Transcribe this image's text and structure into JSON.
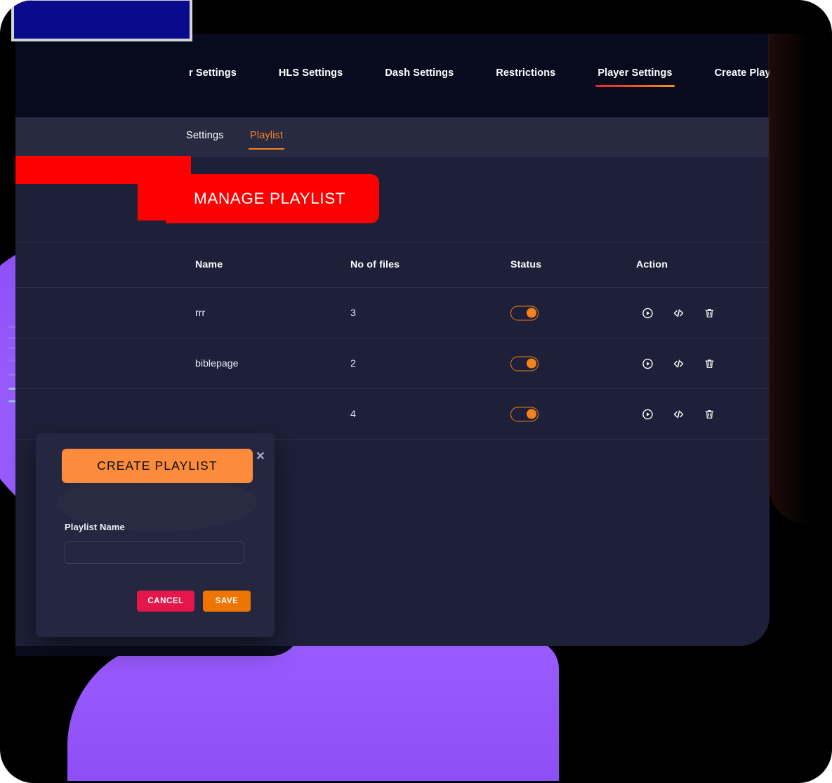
{
  "brand": {
    "accent_orange": "#f5821f",
    "accent_red": "#e8232a",
    "ribbon_red": "#ff0000",
    "cancel_red": "#e4164b",
    "save_orange": "#ee7404",
    "card_bg": "#1e2039",
    "topnav_bg": "#080b1e",
    "subtab_bg": "#282a42",
    "modal_bg": "#252740",
    "modal_header_orange": "#fc8b3c",
    "blob_purple": "#9a5cff",
    "logo_blue": "#0a0a8c"
  },
  "topnav": {
    "items": [
      {
        "label": "r Settings",
        "active": false
      },
      {
        "label": "HLS Settings",
        "active": false
      },
      {
        "label": "Dash Settings",
        "active": false
      },
      {
        "label": "Restrictions",
        "active": false
      },
      {
        "label": "Player Settings",
        "active": true
      },
      {
        "label": "Create Player",
        "active": false
      }
    ]
  },
  "subtabs": {
    "settings_label": "Settings",
    "playlist_label": "Playlist"
  },
  "ribbon": {
    "label": "MANAGE PLAYLIST"
  },
  "toolbar": {
    "create_playlist_label": "Create Playlist"
  },
  "table": {
    "columns": [
      "Name",
      "No of files",
      "Status",
      "Action"
    ],
    "rows": [
      {
        "name": "rrr",
        "files": "3",
        "status": true
      },
      {
        "name": "biblepage",
        "files": "2",
        "status": true
      },
      {
        "name": "",
        "files": "4",
        "status": true
      }
    ],
    "action_icons": [
      "play-circle-icon",
      "code-icon",
      "trash-icon"
    ]
  },
  "back_card": {
    "files_label": "files",
    "action_label": "ion"
  },
  "modal": {
    "title": "CREATE PLAYLIST",
    "close_label": "×",
    "field_label": "Playlist Name",
    "field_value": "",
    "field_placeholder": "",
    "cancel_label": "CANCEL",
    "save_label": "SAVE"
  }
}
